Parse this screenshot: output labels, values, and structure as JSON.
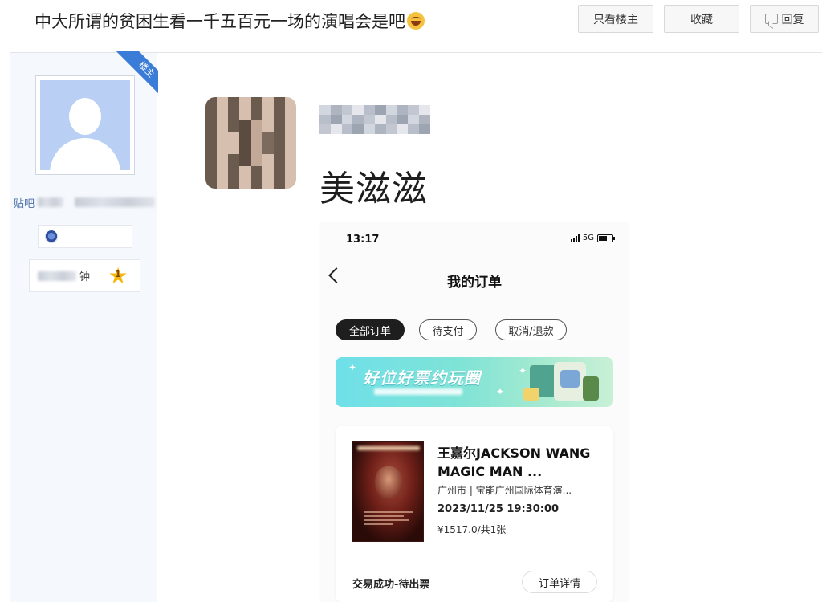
{
  "thread": {
    "title": "中大所谓的贫困生看一千五百元一场的演唱会是吧",
    "actions": {
      "only_op": "只看楼主",
      "favorite": "收藏",
      "reply": "回复"
    }
  },
  "user_panel": {
    "op_badge": "楼主",
    "username_prefix": "贴吧",
    "level_suffix": "钟",
    "level_number": "1"
  },
  "post": {
    "text": "美滋滋"
  },
  "screenshot": {
    "status_time": "13:17",
    "network": "5G",
    "page_title": "我的订单",
    "tabs": [
      "全部订单",
      "待支付",
      "取消/退款"
    ],
    "banner": {
      "title": "好位好票约玩圈"
    },
    "order": {
      "name": "王嘉尔JACKSON WANG MAGIC MAN ...",
      "venue": "广州市 | 宝能广州国际体育演...",
      "datetime": "2023/11/25 19:30:00",
      "price": "¥1517.0/共1张",
      "status": "交易成功-待出票",
      "detail_button": "订单详情"
    }
  },
  "colors": {
    "accent_blue": "#3b7cd8",
    "avatar_bg": "#b9cff4",
    "banner_teal": "#6fe0e9",
    "left_panel_bg": "#f5f8fc"
  }
}
